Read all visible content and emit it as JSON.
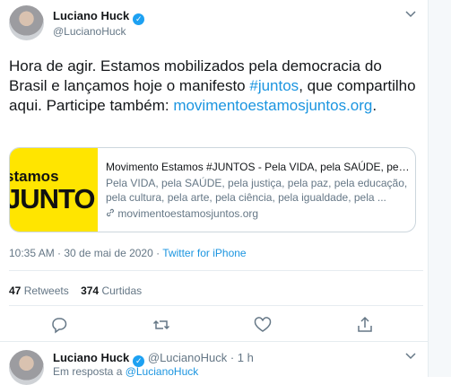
{
  "tweet": {
    "name": "Luciano Huck",
    "verified_glyph": "✓",
    "handle": "@LucianoHuck",
    "menu_icon": "chevron-down-icon",
    "text_part1": "Hora de agir. Estamos mobilizados pela democracia do Brasil e lançamos hoje o manifesto ",
    "hashtag": "#juntos",
    "text_part2": ", que compartilho aqui. Participe também: ",
    "link": "movimentoestamosjuntos.org",
    "text_part3": "."
  },
  "card": {
    "thumb_line1": "stamos",
    "thumb_line2": "JUNTO",
    "thumb_color": "#ffe500",
    "title": "Movimento Estamos #JUNTOS - Pela VIDA, pela SAÚDE, pela j...",
    "description": "Pela VIDA, pela SAÚDE, pela justiça, pela paz, pela educação, pela cultura, pela arte, pela ciência, pela igualdade, pela ...",
    "url": "movimentoestamosjuntos.org",
    "url_icon": "link-icon"
  },
  "meta": {
    "time": "10:35 AM · 30 de mai de 2020 · ",
    "source": "Twitter for iPhone"
  },
  "stats": {
    "retweets_count": "47",
    "retweets_label": "Retweets",
    "likes_count": "374",
    "likes_label": "Curtidas"
  },
  "actions": [
    "reply-icon",
    "retweet-icon",
    "like-icon",
    "share-icon"
  ],
  "reply": {
    "name": "Luciano Huck",
    "handle_time": "@LucianoHuck · 1 h",
    "reply_prefix": "Em resposta a ",
    "reply_handle": "@LucianoHuck"
  },
  "colors": {
    "accent": "#1da1f2",
    "link": "#1b95e0",
    "muted": "#657786"
  }
}
